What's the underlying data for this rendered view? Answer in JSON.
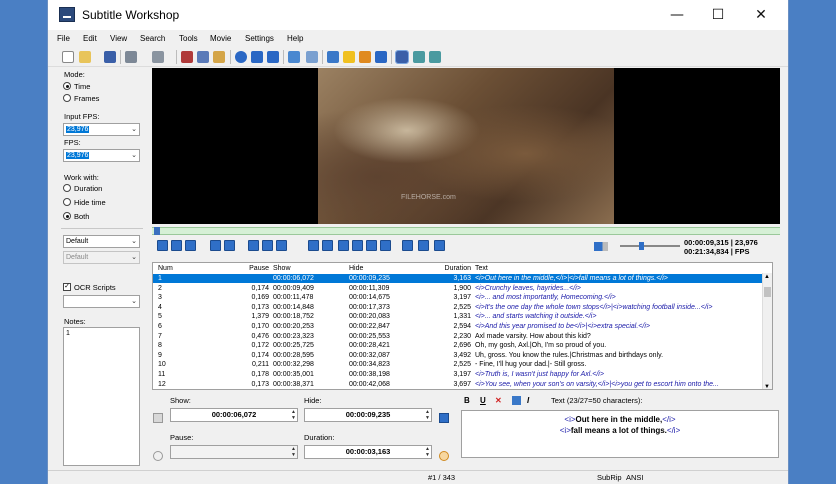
{
  "window": {
    "title": "Subtitle Workshop",
    "controls": {
      "minimize": "—",
      "maximize": "☐",
      "close": "✕"
    }
  },
  "menu": [
    "File",
    "Edit",
    "View",
    "Search",
    "Tools",
    "Movie",
    "Settings",
    "Help"
  ],
  "left_panel": {
    "mode_label": "Mode:",
    "mode_options": [
      "Time",
      "Frames"
    ],
    "mode_selected": "Time",
    "input_fps_label": "Input FPS:",
    "input_fps_value": "23,976",
    "fps_label": "FPS:",
    "fps_value": "23,976",
    "work_with_label": "Work with:",
    "work_with_options": [
      "Duration",
      "Hide time",
      "Both"
    ],
    "work_with_selected": "Both",
    "style_combo_1": "Default",
    "style_combo_2": "Default",
    "ocr_scripts_label": "OCR Scripts",
    "ocr_scripts_checked": true,
    "notes_label": "Notes:",
    "notes_value": "1"
  },
  "video": {
    "watermark": "FILEHORSE.com",
    "current_time": "00:00:09,315",
    "total_time": "00:21:34,834",
    "fps_value": "23,976",
    "fps_unit": "FPS"
  },
  "grid": {
    "headers": {
      "num": "Num",
      "pause": "Pause",
      "show": "Show",
      "hide": "Hide",
      "duration": "Duration",
      "text": "Text"
    },
    "rows": [
      {
        "num": "1",
        "pause": "",
        "show": "00:00:06,072",
        "hide": "00:00:09,235",
        "duration": "3,163",
        "text": "<i>Out here in the middle,</i>|<i>fall means a lot of things.</i>",
        "italic": true,
        "selected": true
      },
      {
        "num": "2",
        "pause": "0,174",
        "show": "00:00:09,409",
        "hide": "00:00:11,309",
        "duration": "1,900",
        "text": "<i>Crunchy leaves, hayrides...</i>",
        "italic": true
      },
      {
        "num": "3",
        "pause": "0,169",
        "show": "00:00:11,478",
        "hide": "00:00:14,675",
        "duration": "3,197",
        "text": "<i>... and most importantly, Homecoming.</i>",
        "italic": true
      },
      {
        "num": "4",
        "pause": "0,173",
        "show": "00:00:14,848",
        "hide": "00:00:17,373",
        "duration": "2,525",
        "text": "<i>It's the one day the whole town stops</i>|<i>watching football inside...</i>",
        "italic": true
      },
      {
        "num": "5",
        "pause": "1,379",
        "show": "00:00:18,752",
        "hide": "00:00:20,083",
        "duration": "1,331",
        "text": "<i>... and starts watching it outside.</i>",
        "italic": true
      },
      {
        "num": "6",
        "pause": "0,170",
        "show": "00:00:20,253",
        "hide": "00:00:22,847",
        "duration": "2,594",
        "text": "<i>And this year promised to be</i>|<i>extra special.</i>",
        "italic": true
      },
      {
        "num": "7",
        "pause": "0,476",
        "show": "00:00:23,323",
        "hide": "00:00:25,553",
        "duration": "2,230",
        "text": "Axl made varsity. How about this kid?",
        "italic": false
      },
      {
        "num": "8",
        "pause": "0,172",
        "show": "00:00:25,725",
        "hide": "00:00:28,421",
        "duration": "2,696",
        "text": "Oh, my gosh, Axl.|Oh, I'm so proud of you.",
        "italic": false
      },
      {
        "num": "9",
        "pause": "0,174",
        "show": "00:00:28,595",
        "hide": "00:00:32,087",
        "duration": "3,492",
        "text": "Uh, gross. You know the rules.|Christmas and birthdays only.",
        "italic": false
      },
      {
        "num": "10",
        "pause": "0,211",
        "show": "00:00:32,298",
        "hide": "00:00:34,823",
        "duration": "2,525",
        "text": "- Fine, I'll hug your dad.|- Still gross.",
        "italic": false
      },
      {
        "num": "11",
        "pause": "0,178",
        "show": "00:00:35,001",
        "hide": "00:00:38,198",
        "duration": "3,197",
        "text": "<i>Truth is, I wasn't just happy for Axl.</i>",
        "italic": true
      },
      {
        "num": "12",
        "pause": "0,173",
        "show": "00:00:38,371",
        "hide": "00:00:42,068",
        "duration": "3,697",
        "text": "<i>You see, when your son's on varsity,</i>|<i>you get to escort him onto the...",
        "italic": true
      }
    ]
  },
  "editor": {
    "show_label": "Show:",
    "show_value": "00:00:06,072",
    "hide_label": "Hide:",
    "hide_value": "00:00:09,235",
    "pause_label": "Pause:",
    "pause_value": "",
    "duration_label": "Duration:",
    "duration_value": "00:00:03,163",
    "text_label": "Text (23/27=50 characters):",
    "format_buttons": [
      "B",
      "U",
      "I"
    ],
    "text_line1": {
      "open": "<i>",
      "body": "Out here in the middle,",
      "close": "</i>"
    },
    "text_line2": {
      "open": "<i>",
      "body": "fall means a lot of things.",
      "close": "</i>"
    }
  },
  "status": {
    "position": "#1 / 343",
    "format": "SubRip",
    "encoding": "ANSI"
  },
  "colors": {
    "selection": "#0078d7",
    "italic_text": "#1a1aa8",
    "desktop": "#4a7fc4",
    "seekbar": "#d6f0d6"
  }
}
